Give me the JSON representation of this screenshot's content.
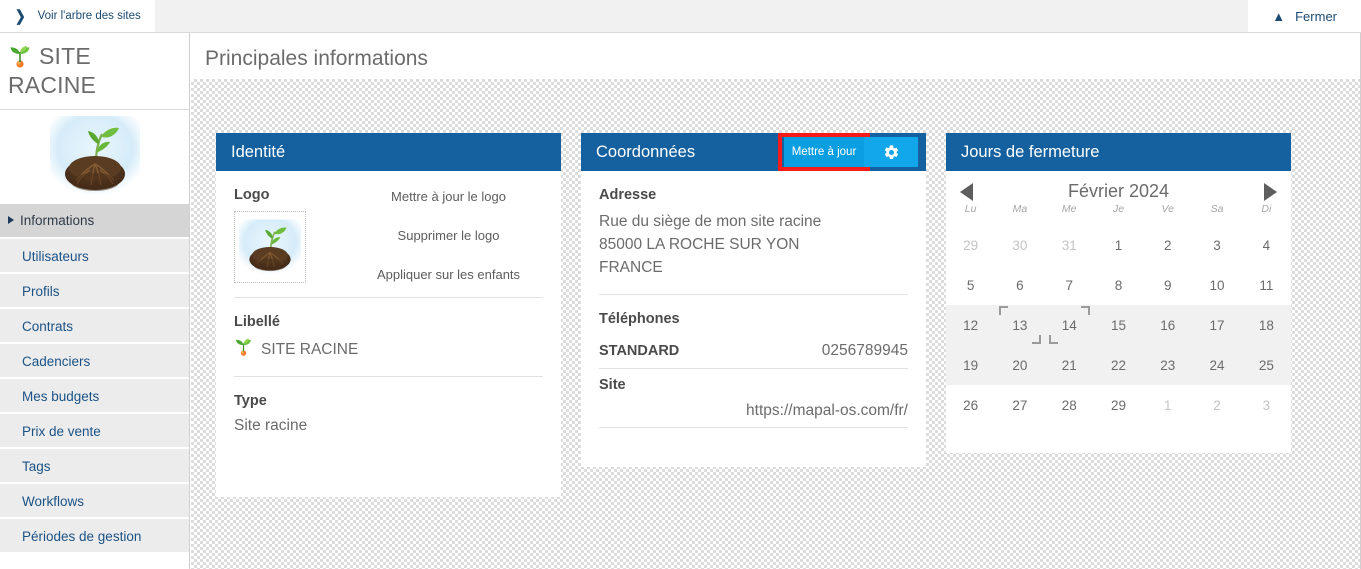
{
  "topbar": {
    "tree_link_label": "Voir l'arbre des sites",
    "tree_icon": "chevron-right-icon",
    "close_label": "Fermer",
    "close_icon": "chevron-up-icon"
  },
  "sidebar": {
    "site_name": "SITE RACINE",
    "site_icon": "sprout-icon",
    "logo_alt": "seedling-with-roots-logo",
    "items": [
      {
        "label": "Informations",
        "active": true
      },
      {
        "label": "Utilisateurs",
        "active": false
      },
      {
        "label": "Profils",
        "active": false
      },
      {
        "label": "Contrats",
        "active": false
      },
      {
        "label": "Cadenciers",
        "active": false
      },
      {
        "label": "Mes budgets",
        "active": false
      },
      {
        "label": "Prix de vente",
        "active": false
      },
      {
        "label": "Tags",
        "active": false
      },
      {
        "label": "Workflows",
        "active": false
      },
      {
        "label": "Périodes de gestion",
        "active": false
      }
    ]
  },
  "main": {
    "page_title": "Principales informations"
  },
  "identity_card": {
    "title": "Identité",
    "logo_label": "Logo",
    "logo_actions": [
      "Mettre à jour le logo",
      "Supprimer le logo",
      "Appliquer sur les enfants"
    ],
    "libelle_label": "Libellé",
    "libelle_value": "SITE RACINE",
    "type_label": "Type",
    "type_value": "Site racine"
  },
  "coordinates_card": {
    "title": "Coordonnées",
    "update_button_label": "Mettre à jour",
    "gear_icon": "gear-icon",
    "highlight_color": "#f51b1b",
    "address_label": "Adresse",
    "address_lines": [
      "Rue du siège de mon site racine",
      "85000 LA ROCHE SUR YON",
      "FRANCE"
    ],
    "phones_label": "Téléphones",
    "phone_type": "STANDARD",
    "phone_number": "0256789945",
    "site_label": "Site",
    "site_url": "https://mapal-os.com/fr/"
  },
  "calendar_card": {
    "title": "Jours de fermeture",
    "prev_icon": "triangle-left-icon",
    "next_icon": "triangle-right-icon",
    "month_label": "Février 2024",
    "day_headers": [
      "Lu",
      "Ma",
      "Me",
      "Je",
      "Ve",
      "Sa",
      "Di"
    ],
    "weeks": [
      {
        "highlight": false,
        "days": [
          {
            "n": "29",
            "muted": true
          },
          {
            "n": "30",
            "muted": true
          },
          {
            "n": "31",
            "muted": true
          },
          {
            "n": "1",
            "muted": false
          },
          {
            "n": "2",
            "muted": false
          },
          {
            "n": "3",
            "muted": false
          },
          {
            "n": "4",
            "muted": false
          }
        ]
      },
      {
        "highlight": false,
        "days": [
          {
            "n": "5",
            "muted": false
          },
          {
            "n": "6",
            "muted": false
          },
          {
            "n": "7",
            "muted": false
          },
          {
            "n": "8",
            "muted": false
          },
          {
            "n": "9",
            "muted": false
          },
          {
            "n": "10",
            "muted": false
          },
          {
            "n": "11",
            "muted": false
          }
        ]
      },
      {
        "highlight": true,
        "days": [
          {
            "n": "12",
            "muted": false
          },
          {
            "n": "13",
            "muted": false,
            "sel": true
          },
          {
            "n": "14",
            "muted": false,
            "sel2": true
          },
          {
            "n": "15",
            "muted": false
          },
          {
            "n": "16",
            "muted": false
          },
          {
            "n": "17",
            "muted": false
          },
          {
            "n": "18",
            "muted": false
          }
        ]
      },
      {
        "highlight": true,
        "days": [
          {
            "n": "19",
            "muted": false
          },
          {
            "n": "20",
            "muted": false
          },
          {
            "n": "21",
            "muted": false
          },
          {
            "n": "22",
            "muted": false
          },
          {
            "n": "23",
            "muted": false
          },
          {
            "n": "24",
            "muted": false
          },
          {
            "n": "25",
            "muted": false
          }
        ]
      },
      {
        "highlight": false,
        "days": [
          {
            "n": "26",
            "muted": false
          },
          {
            "n": "27",
            "muted": false
          },
          {
            "n": "28",
            "muted": false
          },
          {
            "n": "29",
            "muted": false
          },
          {
            "n": "1",
            "muted": true
          },
          {
            "n": "2",
            "muted": true
          },
          {
            "n": "3",
            "muted": true
          }
        ]
      }
    ]
  },
  "theme": {
    "header_blue": "#15619f",
    "button_blue": "#0b9ee0",
    "gear_blue": "#11a7ea",
    "link_blue": "#1b5286"
  }
}
